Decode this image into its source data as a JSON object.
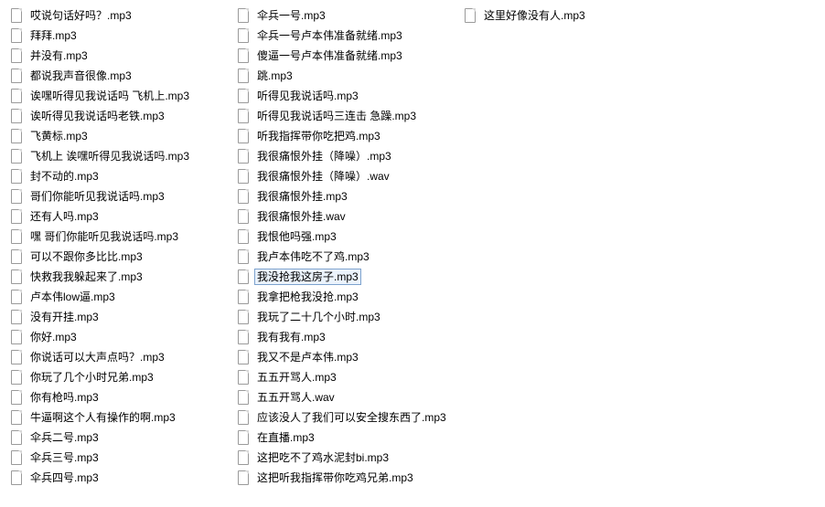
{
  "files": [
    {
      "name": "哎说句话好吗？.mp3",
      "selected": false
    },
    {
      "name": "拜拜.mp3",
      "selected": false
    },
    {
      "name": "并没有.mp3",
      "selected": false
    },
    {
      "name": "都说我声音很像.mp3",
      "selected": false
    },
    {
      "name": "诶嘿听得见我说话吗 飞机上.mp3",
      "selected": false
    },
    {
      "name": "诶听得见我说话吗老铁.mp3",
      "selected": false
    },
    {
      "name": "飞黄标.mp3",
      "selected": false
    },
    {
      "name": "飞机上 诶嘿听得见我说话吗.mp3",
      "selected": false
    },
    {
      "name": "封不动的.mp3",
      "selected": false
    },
    {
      "name": "哥们你能听见我说话吗.mp3",
      "selected": false
    },
    {
      "name": "还有人吗.mp3",
      "selected": false
    },
    {
      "name": "嘿 哥们你能听见我说话吗.mp3",
      "selected": false
    },
    {
      "name": "可以不跟你多比比.mp3",
      "selected": false
    },
    {
      "name": "快救我我躲起来了.mp3",
      "selected": false
    },
    {
      "name": "卢本伟low逼.mp3",
      "selected": false
    },
    {
      "name": "没有开挂.mp3",
      "selected": false
    },
    {
      "name": "你好.mp3",
      "selected": false
    },
    {
      "name": "你说话可以大声点吗？.mp3",
      "selected": false
    },
    {
      "name": "你玩了几个小时兄弟.mp3",
      "selected": false
    },
    {
      "name": "你有枪吗.mp3",
      "selected": false
    },
    {
      "name": "牛逼啊这个人有操作的啊.mp3",
      "selected": false
    },
    {
      "name": "伞兵二号.mp3",
      "selected": false
    },
    {
      "name": "伞兵三号.mp3",
      "selected": false
    },
    {
      "name": "伞兵四号.mp3",
      "selected": false
    },
    {
      "name": "伞兵一号.mp3",
      "selected": false
    },
    {
      "name": "伞兵一号卢本伟准备就绪.mp3",
      "selected": false
    },
    {
      "name": "傻逼一号卢本伟准备就绪.mp3",
      "selected": false
    },
    {
      "name": "跳.mp3",
      "selected": false
    },
    {
      "name": "听得见我说话吗.mp3",
      "selected": false
    },
    {
      "name": "听得见我说话吗三连击 急躁.mp3",
      "selected": false
    },
    {
      "name": "听我指挥带你吃把鸡.mp3",
      "selected": false
    },
    {
      "name": "我很痛恨外挂（降噪）.mp3",
      "selected": false
    },
    {
      "name": "我很痛恨外挂（降噪）.wav",
      "selected": false
    },
    {
      "name": "我很痛恨外挂.mp3",
      "selected": false
    },
    {
      "name": "我很痛恨外挂.wav",
      "selected": false
    },
    {
      "name": "我恨他吗强.mp3",
      "selected": false
    },
    {
      "name": "我卢本伟吃不了鸡.mp3",
      "selected": false
    },
    {
      "name": "我没抢我这房子.mp3",
      "selected": true
    },
    {
      "name": "我拿把枪我没抢.mp3",
      "selected": false
    },
    {
      "name": "我玩了二十几个小时.mp3",
      "selected": false
    },
    {
      "name": "我有我有.mp3",
      "selected": false
    },
    {
      "name": "我又不是卢本伟.mp3",
      "selected": false
    },
    {
      "name": "五五开骂人.mp3",
      "selected": false
    },
    {
      "name": "五五开骂人.wav",
      "selected": false
    },
    {
      "name": "应该没人了我们可以安全搜东西了.mp3",
      "selected": false
    },
    {
      "name": "在直播.mp3",
      "selected": false
    },
    {
      "name": "这把吃不了鸡水泥封bi.mp3",
      "selected": false
    },
    {
      "name": "这把听我指挥带你吃鸡兄弟.mp3",
      "selected": false
    },
    {
      "name": "这里好像没有人.mp3",
      "selected": false
    }
  ]
}
